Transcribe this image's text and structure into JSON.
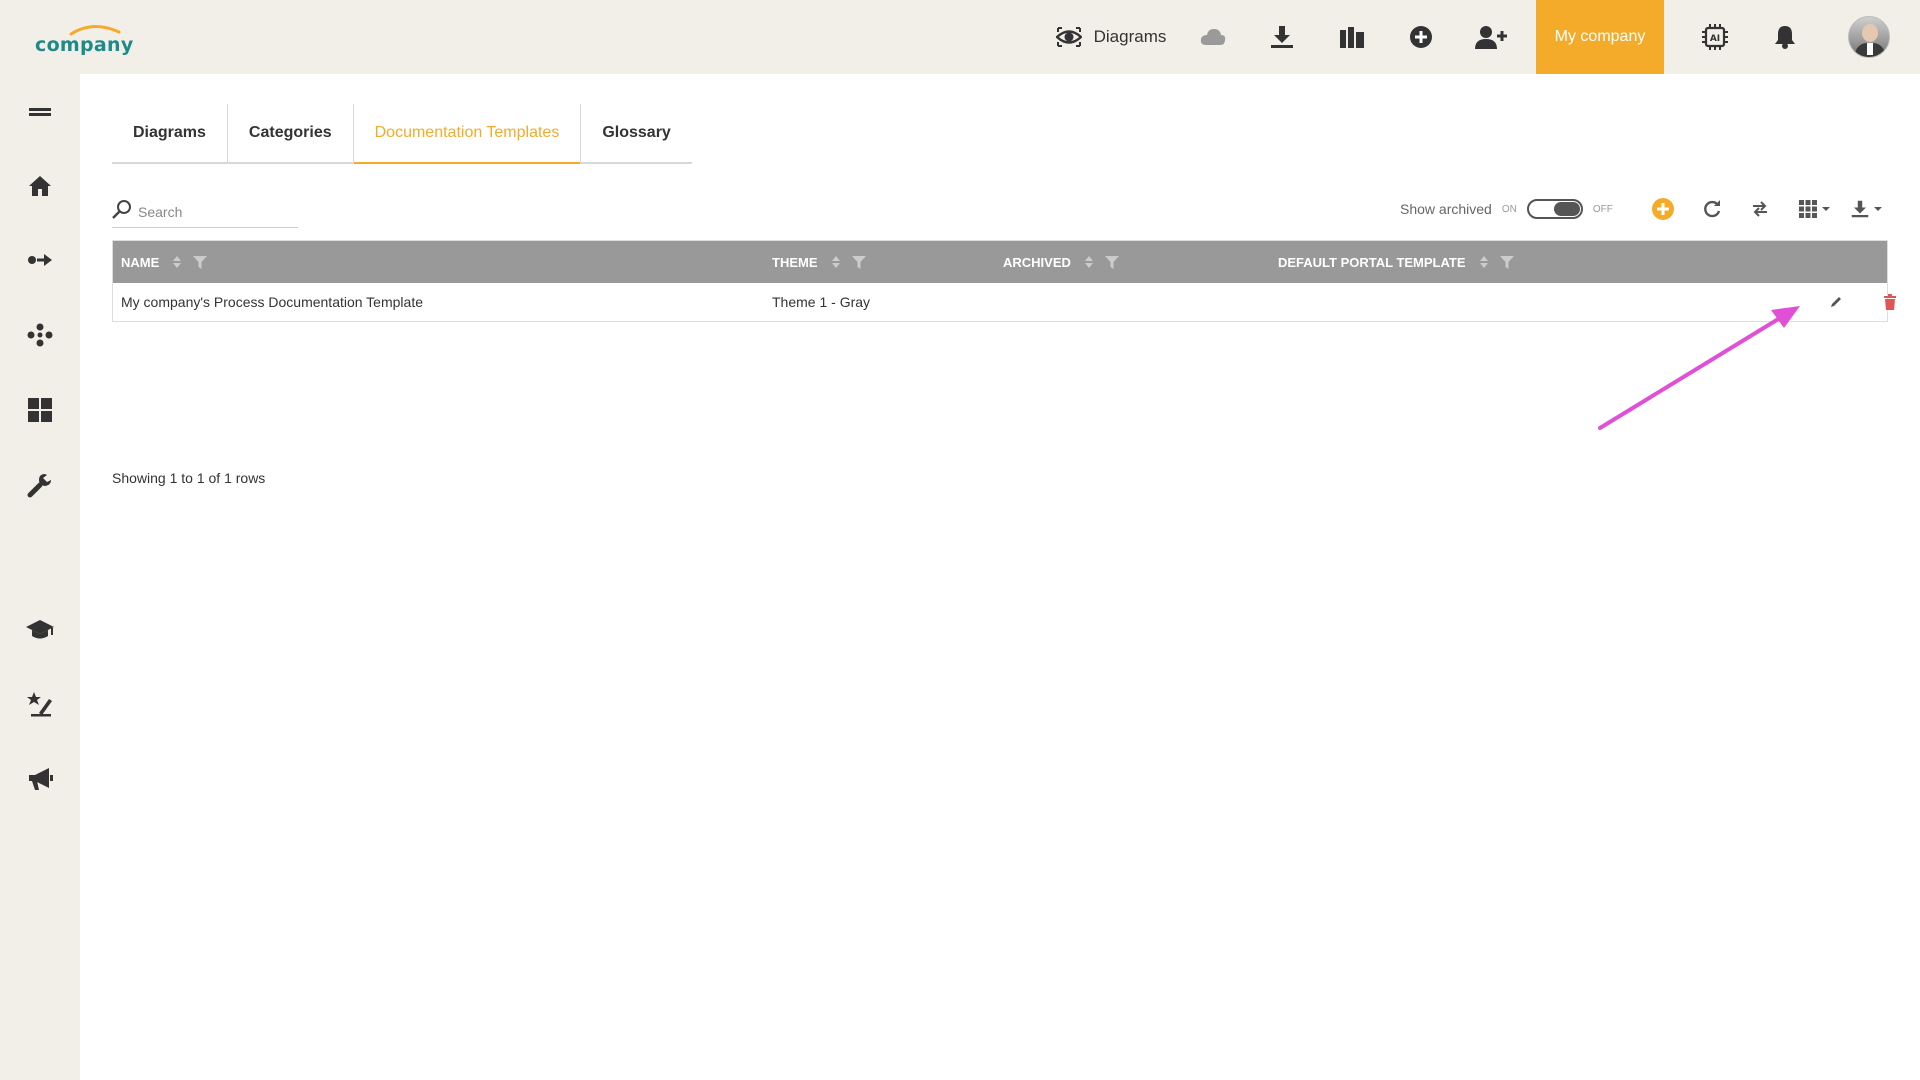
{
  "header": {
    "logo_text": "company",
    "diagrams_label": "Diagrams",
    "company_label": "My company",
    "icons": [
      "eye-icon",
      "cloud-icon",
      "download-icon",
      "library-icon",
      "plus-circle-icon",
      "add-user-icon",
      "ai-chip-icon",
      "bell-icon"
    ]
  },
  "sidebar": {
    "items": [
      "menu-icon",
      "home-icon",
      "process-icon",
      "network-icon",
      "dashboard-icon",
      "wrench-icon",
      "graduation-cap-icon",
      "star-pen-icon",
      "megaphone-icon"
    ]
  },
  "tabs": [
    {
      "label": "Diagrams",
      "active": false
    },
    {
      "label": "Categories",
      "active": false
    },
    {
      "label": "Documentation Templates",
      "active": true
    },
    {
      "label": "Glossary",
      "active": false
    }
  ],
  "search": {
    "placeholder": "Search"
  },
  "toolbar": {
    "show_archived_label": "Show archived",
    "toggle_on": "ON",
    "toggle_off": "OFF",
    "accent_color": "#f4ab2a"
  },
  "table": {
    "columns": [
      "NAME",
      "THEME",
      "ARCHIVED",
      "DEFAULT PORTAL TEMPLATE"
    ],
    "rows": [
      {
        "name": "My company's Process Documentation Template",
        "theme": "Theme 1 - Gray",
        "archived": "",
        "default_portal_template": ""
      }
    ]
  },
  "footer": {
    "showing": "Showing 1 to 1 of 1 rows"
  },
  "annotation": {
    "color": "#e04fd6"
  }
}
